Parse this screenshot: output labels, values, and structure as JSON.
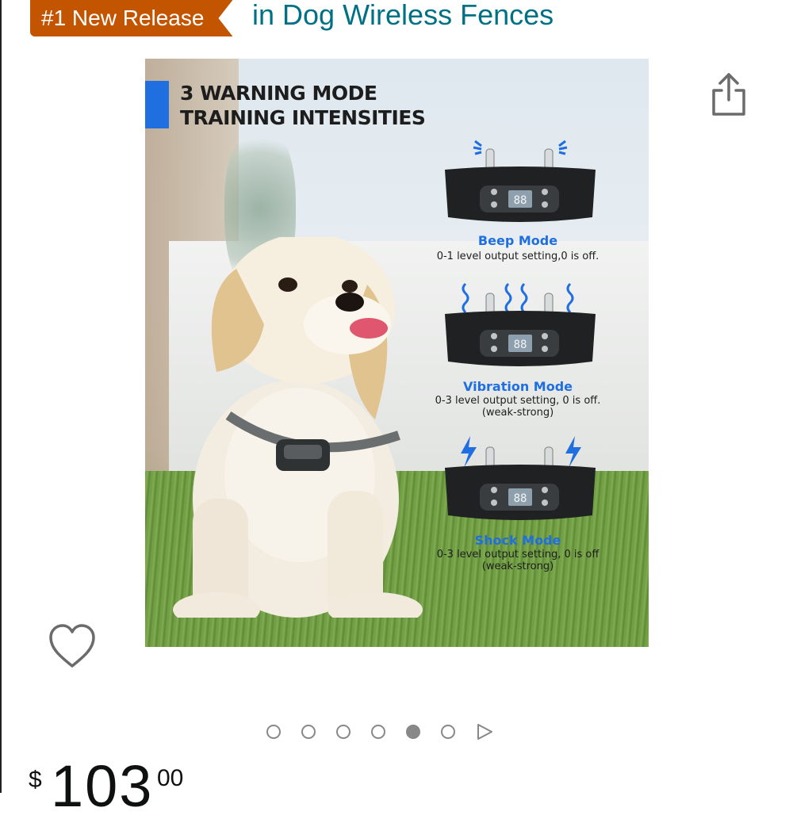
{
  "badge": {
    "label": "#1 New Release",
    "color": "#c45500"
  },
  "category": {
    "text": "in Dog Wireless Fences",
    "color": "#007185"
  },
  "product_image": {
    "headline_line1": "3 WARNING MODE",
    "headline_line2": "TRAINING INTENSITIES",
    "collar_display": "88",
    "modes": [
      {
        "name": "Beep Mode",
        "desc1": "0-1 level output setting,0 is off.",
        "desc2": ""
      },
      {
        "name": "Vibration Mode",
        "desc1": "0-3 level output setting, 0 is off.",
        "desc2": "(weak-strong)"
      },
      {
        "name": "Shock Mode",
        "desc1": "0-3 level output setting, 0 is off",
        "desc2": "(weak-strong)"
      }
    ],
    "accent_color": "#1f6fe0"
  },
  "actions": {
    "share_icon": "share-icon",
    "wishlist_icon": "heart-outline-icon"
  },
  "carousel": {
    "total_images": 6,
    "active_index": 4,
    "has_video_arrow": true
  },
  "price": {
    "symbol": "$",
    "whole": "103",
    "fraction": "00"
  }
}
